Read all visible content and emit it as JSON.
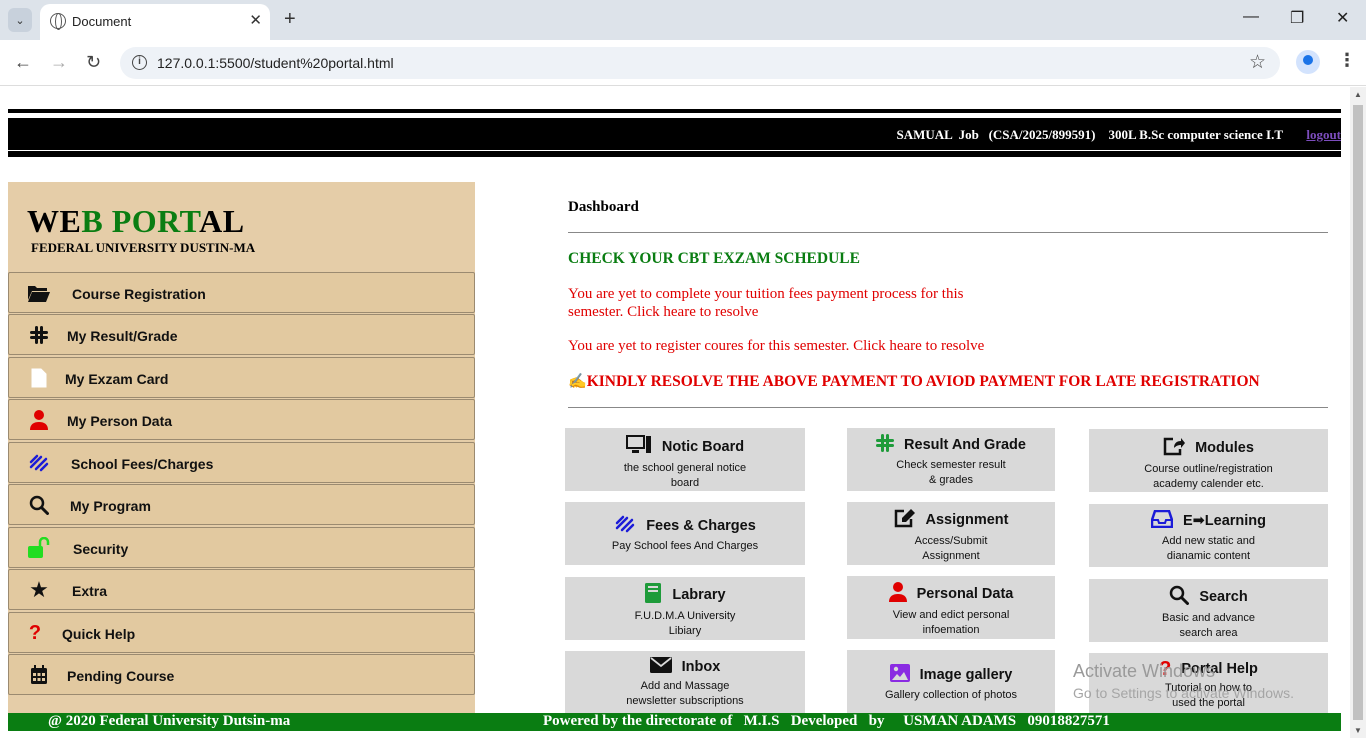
{
  "browser": {
    "tab_title": "Document",
    "url": "127.0.0.1:5500/student%20portal.html",
    "new_tab": "+",
    "minimize": "—",
    "restore": "❐",
    "close": "✕"
  },
  "header": {
    "user_info": "SAMUAL  Job   (CSA/2025/899591)    300L B.Sc computer science I.T",
    "logout": "logout"
  },
  "sidebar": {
    "logo_black1": "WE",
    "logo_green1": "B PORT",
    "logo_black2": "AL",
    "subtitle": "FEDERAL UNIVERSITY DUSTIN-MA",
    "items": [
      {
        "label": "Course Registration",
        "icon": "folder-open-icon"
      },
      {
        "label": "My Result/Grade",
        "icon": "slack-icon"
      },
      {
        "label": "My Exzam Card",
        "icon": "file-icon"
      },
      {
        "label": "My Person Data",
        "icon": "user-icon"
      },
      {
        "label": "School Fees/Charges",
        "icon": "squarespace-icon"
      },
      {
        "label": "My Program",
        "icon": "search-icon"
      },
      {
        "label": "Security",
        "icon": "unlock-icon"
      },
      {
        "label": "Extra",
        "icon": "star-icon"
      },
      {
        "label": "Quick Help",
        "icon": "question-icon"
      },
      {
        "label": "Pending Course",
        "icon": "calendar-icon"
      }
    ]
  },
  "main": {
    "title": "Dashboard",
    "cbt": "CHECK YOUR CBT EXZAM SCHEDULE",
    "msg_fees_1": "You are yet to complete your tuition fees payment process for this",
    "msg_fees_2": "semester. Click heare to resolve",
    "msg_courses": "You are yet to register coures for this semester. Click heare to resolve",
    "warning": "KINDLY RESOLVE THE ABOVE PAYMENT TO AVIOD PAYMENT FOR LATE REGISTRATION",
    "cards": [
      {
        "title": "Notic Board",
        "desc1": "the school general notice",
        "desc2": "board",
        "icon": "desktop-icon"
      },
      {
        "title": "Result And Grade",
        "desc1": "Check semester result",
        "desc2": "& grades",
        "icon": "slack-icon"
      },
      {
        "title": "Modules",
        "desc1": "Course outline/registration",
        "desc2": "academy calender etc.",
        "icon": "share-square-icon"
      },
      {
        "title": "Fees & Charges",
        "desc1": "Pay School fees And Charges",
        "desc2": "",
        "icon": "squarespace-icon"
      },
      {
        "title": "Assignment",
        "desc1": "Access/Submit",
        "desc2": "Assignment",
        "icon": "edit-icon"
      },
      {
        "title": "E➡Learning",
        "desc1": "Add new static and",
        "desc2": "dianamic content",
        "icon": "inbox-icon"
      },
      {
        "title": "Labrary",
        "desc1": "F.U.D.M.A University",
        "desc2": "Libiary",
        "icon": "book-icon"
      },
      {
        "title": "Personal Data",
        "desc1": "View and edict personal",
        "desc2": "infoemation",
        "icon": "user-icon"
      },
      {
        "title": "Search",
        "desc1": "Basic and advance",
        "desc2": "search area",
        "icon": "search-icon"
      },
      {
        "title": "Inbox",
        "desc1": "Add and Massage",
        "desc2": "newsletter subscriptions",
        "icon": "envelope-icon"
      },
      {
        "title": "Image gallery",
        "desc1": "Gallery collection of photos",
        "desc2": "",
        "icon": "image-icon"
      },
      {
        "title": "Portal Help",
        "desc1": "Tutorial on how to",
        "desc2": "used the portal",
        "icon": "question-icon"
      }
    ]
  },
  "watermark": {
    "line1": "Activate Windows",
    "line2": "Go to Settings to activate Windows."
  },
  "footer": {
    "left": "@ 2020 Federal University Dutsin-ma",
    "right": "Powered by the directorate of   M.I.S   Developed   by     USMAN ADAMS   09018827571"
  },
  "colors": {
    "green": "#0a7d12",
    "red": "#e00000",
    "sidebar_bg": "#e5cda8",
    "card_bg": "#d9d9d9"
  }
}
